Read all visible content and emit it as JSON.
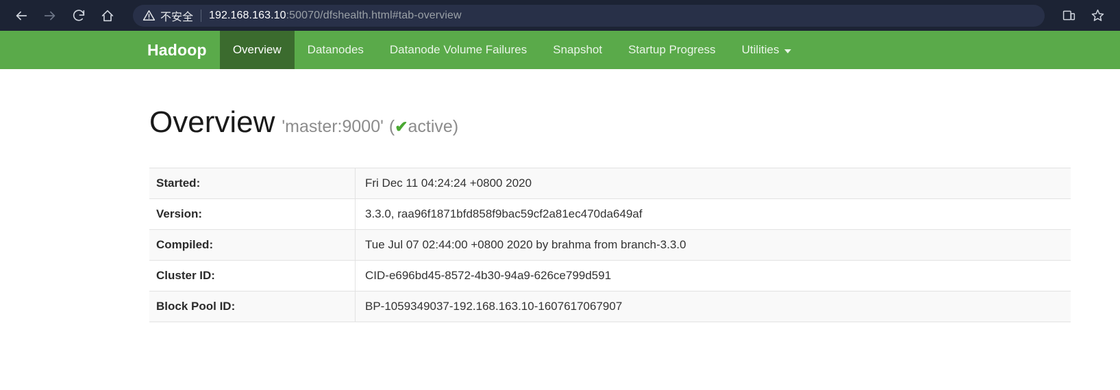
{
  "browser": {
    "back_icon": "arrow-left-icon",
    "forward_icon": "arrow-right-icon",
    "reload_icon": "reload-icon",
    "home_icon": "home-icon",
    "security_warning": "不安全",
    "url_host": "192.168.163.10",
    "url_rest": ":50070/dfshealth.html#tab-overview",
    "url_full": "192.168.163.10:50070/dfshealth.html#tab-overview",
    "devtools_icon": "device-toolbar-icon",
    "bookmark_icon": "star-icon"
  },
  "navbar": {
    "brand": "Hadoop",
    "items": [
      {
        "label": "Overview",
        "active": true
      },
      {
        "label": "Datanodes",
        "active": false
      },
      {
        "label": "Datanode Volume Failures",
        "active": false
      },
      {
        "label": "Snapshot",
        "active": false
      },
      {
        "label": "Startup Progress",
        "active": false
      },
      {
        "label": "Utilities",
        "active": false,
        "has_caret": true
      }
    ],
    "background_color": "#5aaa4a",
    "active_color": "#3b6b2e"
  },
  "page": {
    "title": "Overview",
    "subtitle_host": "'master:9000'",
    "status_open": "(",
    "status_check": "✔",
    "status_label": "active",
    "status_close": ")",
    "status_color": "#4aa832"
  },
  "info_table": {
    "rows": [
      {
        "label": "Started:",
        "value": "Fri Dec 11 04:24:24 +0800 2020"
      },
      {
        "label": "Version:",
        "value": "3.3.0, raa96f1871bfd858f9bac59cf2a81ec470da649af"
      },
      {
        "label": "Compiled:",
        "value": "Tue Jul 07 02:44:00 +0800 2020 by brahma from branch-3.3.0"
      },
      {
        "label": "Cluster ID:",
        "value": "CID-e696bd45-8572-4b30-94a9-626ce799d591"
      },
      {
        "label": "Block Pool ID:",
        "value": "BP-1059349037-192.168.163.10-1607617067907"
      }
    ]
  }
}
